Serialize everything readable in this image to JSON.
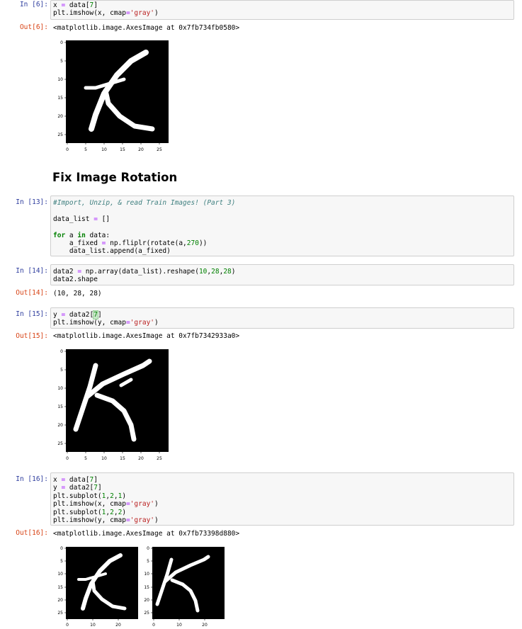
{
  "cells": [
    {
      "prompt": "In [6]:",
      "code": [
        "x = data[7]",
        "plt.imshow(x, cmap='gray')"
      ]
    },
    {
      "prompt": "Out[6]:",
      "output": "<matplotlib.image.AxesImage at 0x7fb734fb0580>"
    },
    {
      "prompt": "In [13]:",
      "code": [
        "#Import, Unzip, & read Train Images! (Part 3)",
        "",
        "data_list = []",
        "",
        "for a in data:",
        "    a_fixed = np.fliplr(rotate(a,270))",
        "    data_list.append(a_fixed)"
      ]
    },
    {
      "prompt": "In [14]:",
      "code": [
        "data2 = np.array(data_list).reshape(10,28,28)",
        "data2.shape"
      ]
    },
    {
      "prompt": "Out[14]:",
      "output": "(10, 28, 28)"
    },
    {
      "prompt": "In [15]:",
      "code": [
        "y = data2[7]",
        "plt.imshow(y, cmap='gray')"
      ]
    },
    {
      "prompt": "Out[15]:",
      "output": "<matplotlib.image.AxesImage at 0x7fb7342933a0>"
    },
    {
      "prompt": "In [16]:",
      "code": [
        "x = data[7]",
        "y = data2[7]",
        "plt.subplot(1,2,1)",
        "plt.imshow(x, cmap='gray')",
        "plt.subplot(1,2,2)",
        "plt.imshow(y, cmap='gray')"
      ]
    },
    {
      "prompt": "Out[16]:",
      "output": "<matplotlib.image.AxesImage at 0x7fb73398d880>"
    }
  ],
  "heading": "Fix Image Rotation",
  "plots": {
    "ticks_full": [
      "0",
      "5",
      "10",
      "15",
      "20",
      "25"
    ],
    "ticks_sub_y": [
      "0",
      "5",
      "10",
      "15",
      "20",
      "25"
    ],
    "ticks_sub_x": [
      "0",
      "10",
      "20"
    ]
  },
  "colors": {
    "in_prompt": "#303f9f",
    "out_prompt": "#d84315",
    "cell_bg": "#f7f7f7",
    "cell_border": "#cfcfcf"
  }
}
